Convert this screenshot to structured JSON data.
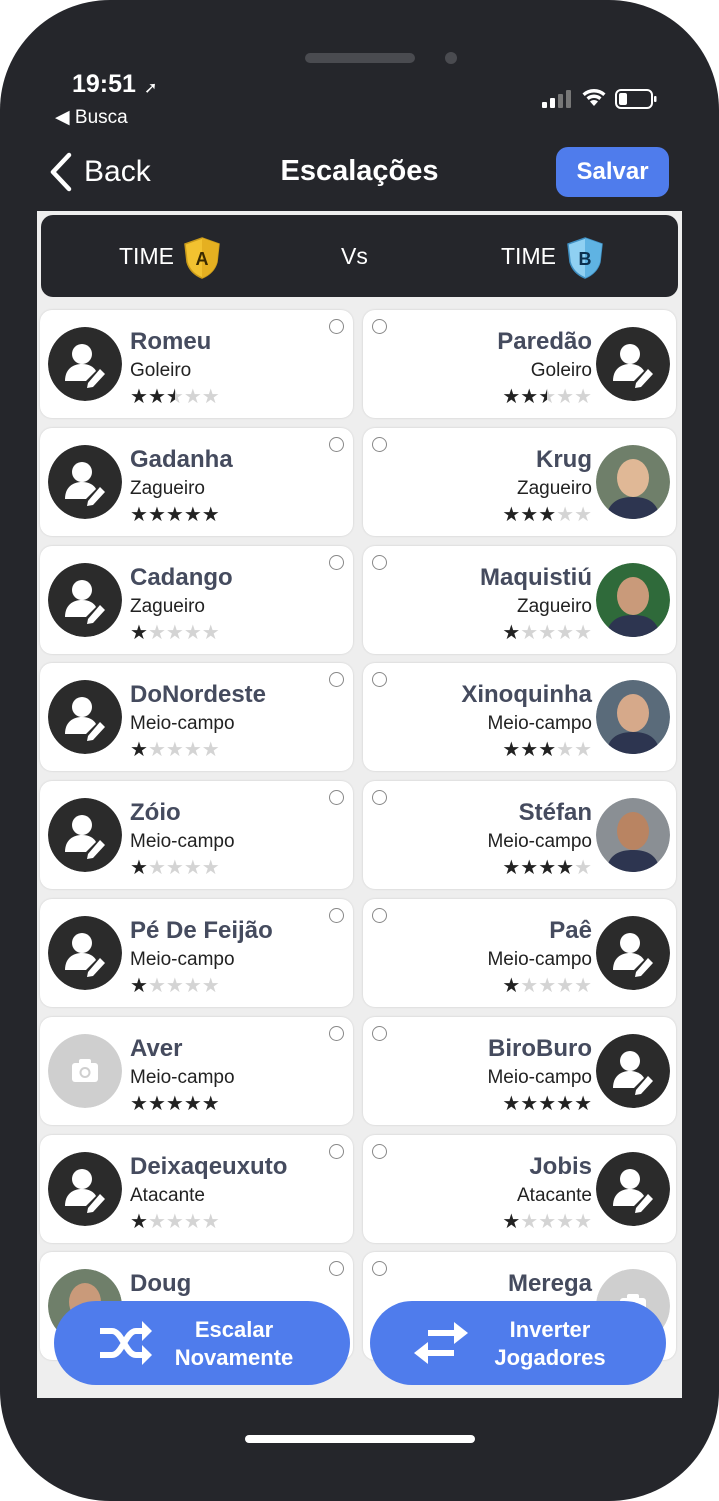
{
  "status_bar": {
    "time": "19:51",
    "back_app": "◀ Busca"
  },
  "nav": {
    "back_label": "Back",
    "title": "Escalações",
    "save_label": "Salvar"
  },
  "teams": {
    "team_a_label": "TIME",
    "team_a_badge": "A",
    "vs": "Vs",
    "team_b_label": "TIME",
    "team_b_badge": "B"
  },
  "left_players": [
    {
      "name": "Romeu",
      "position": "Goleiro",
      "rating": 2.5,
      "avatar": "person-edit-icon"
    },
    {
      "name": "Gadanha",
      "position": "Zagueiro",
      "rating": 5,
      "avatar": "person-edit-icon"
    },
    {
      "name": "Cadango",
      "position": "Zagueiro",
      "rating": 1,
      "avatar": "person-edit-icon"
    },
    {
      "name": "DoNordeste",
      "position": "Meio-campo",
      "rating": 1,
      "avatar": "person-edit-icon"
    },
    {
      "name": "Zóio",
      "position": "Meio-campo",
      "rating": 1,
      "avatar": "person-edit-icon"
    },
    {
      "name": "Pé De Feijão",
      "position": "Meio-campo",
      "rating": 1,
      "avatar": "person-edit-icon"
    },
    {
      "name": "Aver",
      "position": "Meio-campo",
      "rating": 5,
      "avatar": "camera-icon"
    },
    {
      "name": "Deixaqeuxuto",
      "position": "Atacante",
      "rating": 1,
      "avatar": "person-edit-icon"
    },
    {
      "name": "Doug",
      "position": "",
      "rating": 0,
      "avatar": "photo"
    }
  ],
  "right_players": [
    {
      "name": "Paredão",
      "position": "Goleiro",
      "rating": 2.5,
      "avatar": "person-edit-icon"
    },
    {
      "name": "Krug",
      "position": "Zagueiro",
      "rating": 3,
      "avatar": "photo"
    },
    {
      "name": "Maquistiú",
      "position": "Zagueiro",
      "rating": 1,
      "avatar": "photo"
    },
    {
      "name": "Xinoquinha",
      "position": "Meio-campo",
      "rating": 3,
      "avatar": "photo"
    },
    {
      "name": "Stéfan",
      "position": "Meio-campo",
      "rating": 4,
      "avatar": "photo"
    },
    {
      "name": "Paê",
      "position": "Meio-campo",
      "rating": 1,
      "avatar": "person-edit-icon"
    },
    {
      "name": "BiroBuro",
      "position": "Meio-campo",
      "rating": 5,
      "avatar": "person-edit-icon"
    },
    {
      "name": "Jobis",
      "position": "Atacante",
      "rating": 1,
      "avatar": "person-edit-icon"
    },
    {
      "name": "Merega",
      "position": "",
      "rating": 0,
      "avatar": "camera-icon"
    }
  ],
  "actions": {
    "reshuffle_label_1": "Escalar",
    "reshuffle_label_2": "Novamente",
    "swap_label_1": "Inverter",
    "swap_label_2": "Jogadores"
  },
  "colors": {
    "accent": "#4f7cec",
    "dark": "#25262b",
    "shield_a": "#f2c230",
    "shield_b": "#6bbde8"
  }
}
